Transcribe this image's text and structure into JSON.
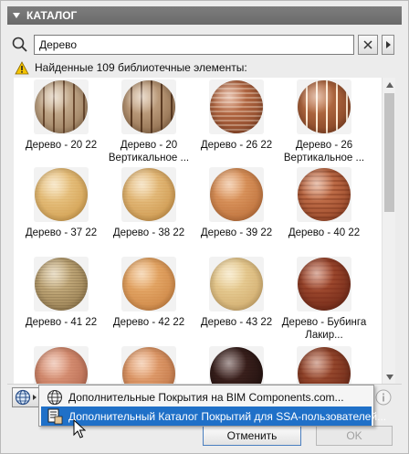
{
  "panel": {
    "title": "КАТАЛОГ"
  },
  "search": {
    "value": "Дерево"
  },
  "status": {
    "text": "Найденные 109 библиотечные элементы:"
  },
  "items": [
    {
      "label": "Дерево - 20 22",
      "c1": "#d9c3a6",
      "c2": "#8a6a4a",
      "stripes": "#6b4a30",
      "style": "vertical"
    },
    {
      "label": "Дерево - 20 Вертикальное ...",
      "c1": "#d4b696",
      "c2": "#7e5a3a",
      "stripes": "#5a3a22",
      "style": "vertical"
    },
    {
      "label": "Дерево - 26 22",
      "c1": "#c97a52",
      "c2": "#7a3a1e",
      "stripes": "#fff2e0",
      "style": "horizontal"
    },
    {
      "label": "Дерево - 26 Вертикальное ...",
      "c1": "#c57a4e",
      "c2": "#74361a",
      "stripes": "#ffe9d2",
      "style": "vertical"
    },
    {
      "label": "Дерево - 37 22",
      "c1": "#f2d49a",
      "c2": "#c9923e",
      "stripes": "#d8a55a",
      "style": "fine"
    },
    {
      "label": "Дерево - 38 22",
      "c1": "#f0cf96",
      "c2": "#c48a3c",
      "stripes": "#d49a52",
      "style": "fine"
    },
    {
      "label": "Дерево - 39 22",
      "c1": "#eaa870",
      "c2": "#b0622e",
      "stripes": "#c9783e",
      "style": "fine"
    },
    {
      "label": "Дерево - 40 22",
      "c1": "#d6835a",
      "c2": "#8a3a1e",
      "stripes": "#6e2a12",
      "style": "horizontal"
    },
    {
      "label": "Дерево - 41 22",
      "c1": "#d8c090",
      "c2": "#8a7044",
      "stripes": "#6a5432",
      "style": "fine"
    },
    {
      "label": "Дерево - 42 22",
      "c1": "#f0b878",
      "c2": "#c47a3a",
      "stripes": "#d28a46",
      "style": "fine"
    },
    {
      "label": "Дерево - 43 22",
      "c1": "#f2dca6",
      "c2": "#c8a060",
      "stripes": "#d6b072",
      "style": "fine"
    },
    {
      "label": "Дерево - Бубинга Лакир...",
      "c1": "#b85a3a",
      "c2": "#5e1e10",
      "stripes": "#7a2a18",
      "style": "horizontal"
    },
    {
      "label": "",
      "c1": "#e8a486",
      "c2": "#a85a42",
      "stripes": "#c0765c",
      "style": "fine"
    },
    {
      "label": "",
      "c1": "#f0b080",
      "c2": "#b4683a",
      "stripes": "#c87a46",
      "style": "fine"
    },
    {
      "label": "",
      "c1": "#4a2a26",
      "c2": "#160a08",
      "stripes": "#2a1412",
      "style": "fine"
    },
    {
      "label": "",
      "c1": "#b05a3a",
      "c2": "#5a1e10",
      "stripes": "#7a2c18",
      "style": "horizontal"
    }
  ],
  "menu": {
    "item1": "Дополнительные Покрытия на BIM Components.com...",
    "item2": "Дополнительный Каталог Покрытий для SSA-пользователей..."
  },
  "buttons": {
    "cancel": "Отменить",
    "ok": "OK"
  },
  "colors": {
    "header": "#6e6e6e",
    "highlight": "#1f70c8",
    "warning": "#f5c400"
  }
}
